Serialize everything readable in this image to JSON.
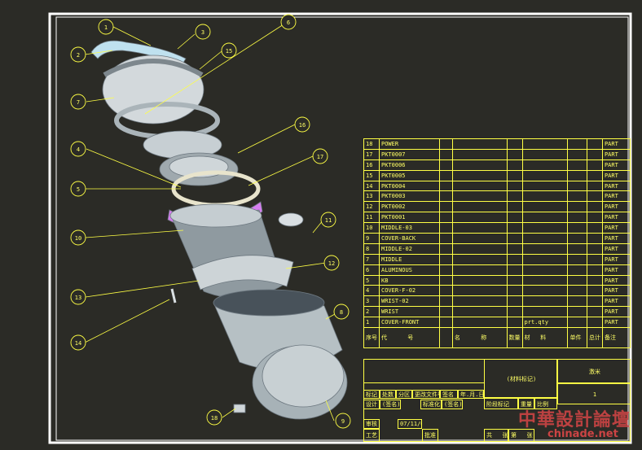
{
  "colors": {
    "background": "#2b2b26",
    "frame": "#ffffff",
    "table_lines": "#ffff44",
    "text": "#ffff66",
    "balloon": "#ffff44",
    "parts": "#b9c4c8",
    "highlight": "#d67ef0",
    "watermark": "#cc4444"
  },
  "balloons": [
    "1",
    "2",
    "3",
    "4",
    "5",
    "6",
    "7",
    "8",
    "9",
    "10",
    "11",
    "12",
    "13",
    "14",
    "15",
    "16",
    "17",
    "18"
  ],
  "bom_rows": [
    {
      "no": "18",
      "name": "POWER",
      "type": "PART"
    },
    {
      "no": "17",
      "name": "PKT0007",
      "type": "PART"
    },
    {
      "no": "16",
      "name": "PKT0006",
      "type": "PART"
    },
    {
      "no": "15",
      "name": "PKT0005",
      "type": "PART"
    },
    {
      "no": "14",
      "name": "PKT0004",
      "type": "PART"
    },
    {
      "no": "13",
      "name": "PKT0003",
      "type": "PART"
    },
    {
      "no": "12",
      "name": "PKT0002",
      "type": "PART"
    },
    {
      "no": "11",
      "name": "PKT0001",
      "type": "PART"
    },
    {
      "no": "10",
      "name": "MIDDLE-03",
      "type": "PART"
    },
    {
      "no": "9",
      "name": "COVER-BACK",
      "type": "PART"
    },
    {
      "no": "8",
      "name": "MIDDLE-02",
      "type": "PART"
    },
    {
      "no": "7",
      "name": "MIDDLE",
      "type": "PART"
    },
    {
      "no": "6",
      "name": "ALUMINOUS",
      "type": "PART"
    },
    {
      "no": "5",
      "name": "KB",
      "type": "PART"
    },
    {
      "no": "4",
      "name": "COVER-F-02",
      "type": "PART"
    },
    {
      "no": "3",
      "name": "WRIST-02",
      "type": "PART"
    },
    {
      "no": "2",
      "name": "WRIST",
      "type": "PART"
    },
    {
      "no": "1",
      "name": "COVER-FRONT",
      "type": "PART",
      "qty": "prt.qty"
    }
  ],
  "bom_header": {
    "seq": "序号",
    "code": "代",
    "code2": "号",
    "name": "名",
    "name2": "称",
    "qty": "数量",
    "material": "材",
    "material2": "料",
    "single": "单件",
    "total": "总计",
    "weight": "重量",
    "remark": "备注"
  },
  "title_block": {
    "material_mark": "(材料标记)",
    "drawing_title": "激米",
    "mark": "标记",
    "count": "处数",
    "zone": "分区",
    "change_no": "更改文件号",
    "sign": "签名",
    "date": "年.月.日",
    "design": "设计",
    "design_sign": "(签名)",
    "std": "标准化",
    "std_sign": "(签名)",
    "review": "审核",
    "review_date": "07/11/06",
    "process": "工艺",
    "approve": "批准",
    "stage_mark": "阶段标记",
    "weight": "重量",
    "scale": "比例",
    "total": "共",
    "sheet": "张",
    "sheet2": "第",
    "sheet3": "张",
    "scale_value": "1"
  },
  "watermark": {
    "line1": "中華設計論壇",
    "line2": "chinade.net"
  }
}
